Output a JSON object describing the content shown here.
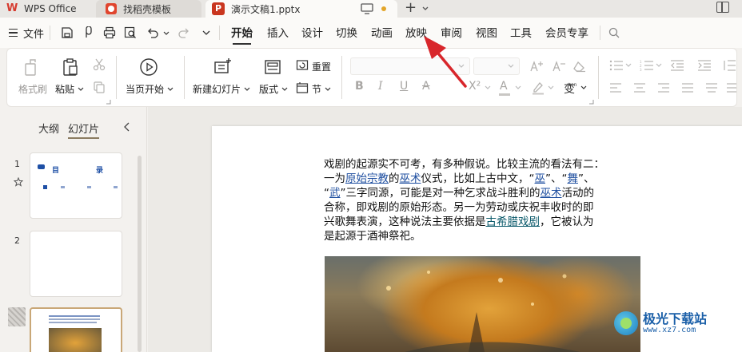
{
  "tabs": {
    "wps": "WPS Office",
    "templates": "找稻壳模板",
    "document": "演示文稿1.pptx",
    "ppt_badge": "P"
  },
  "menu": {
    "file": "文件",
    "items": [
      "开始",
      "插入",
      "设计",
      "切换",
      "动画",
      "放映",
      "审阅",
      "视图",
      "工具",
      "会员专享"
    ],
    "active": "开始"
  },
  "ribbon": {
    "format_painter": "格式刷",
    "paste": "粘贴",
    "start_from_current": "当页开始",
    "new_slide": "新建幻灯片",
    "layout": "版式",
    "reset": "重置",
    "section": "节"
  },
  "left_panel": {
    "tab_outline": "大纲",
    "tab_slides": "幻灯片",
    "slide_numbers": [
      "1",
      "2"
    ],
    "thumb1": {
      "title_left": "目",
      "title_right": "录"
    }
  },
  "slide": {
    "line1": "戏剧的起源实不可考，有多种假说。比较主流的看法有二：",
    "line2_a": "一为",
    "line2_link1": "原始宗教",
    "line2_b": "的",
    "line2_link2": "巫术",
    "line2_c": "仪式，比如上古中文，“",
    "line2_w1": "巫",
    "line2_d": "”、“",
    "line2_w2": "舞",
    "line2_e": "”、",
    "line3_a": "“",
    "line3_w3": "武",
    "line3_b": "”三字同源，可能是对一种乞求战斗胜利的",
    "line3_link3": "巫术",
    "line3_c": "活动的",
    "line4": "合称，即戏剧的原始形态。另一为劳动或庆祝丰收时的即",
    "line5_a": "兴歌舞表演，这种说法主要依据是",
    "line5_link4": "古希腊戏剧",
    "line5_b": "，它被认为",
    "line6": "是起源于酒神祭祀。"
  },
  "watermark": {
    "name": "极光下载站",
    "url": "www.xz7.com"
  },
  "colors": {
    "accent_red": "#d8262b",
    "link_blue": "#1f4fa0",
    "active_underline": "#333333"
  }
}
